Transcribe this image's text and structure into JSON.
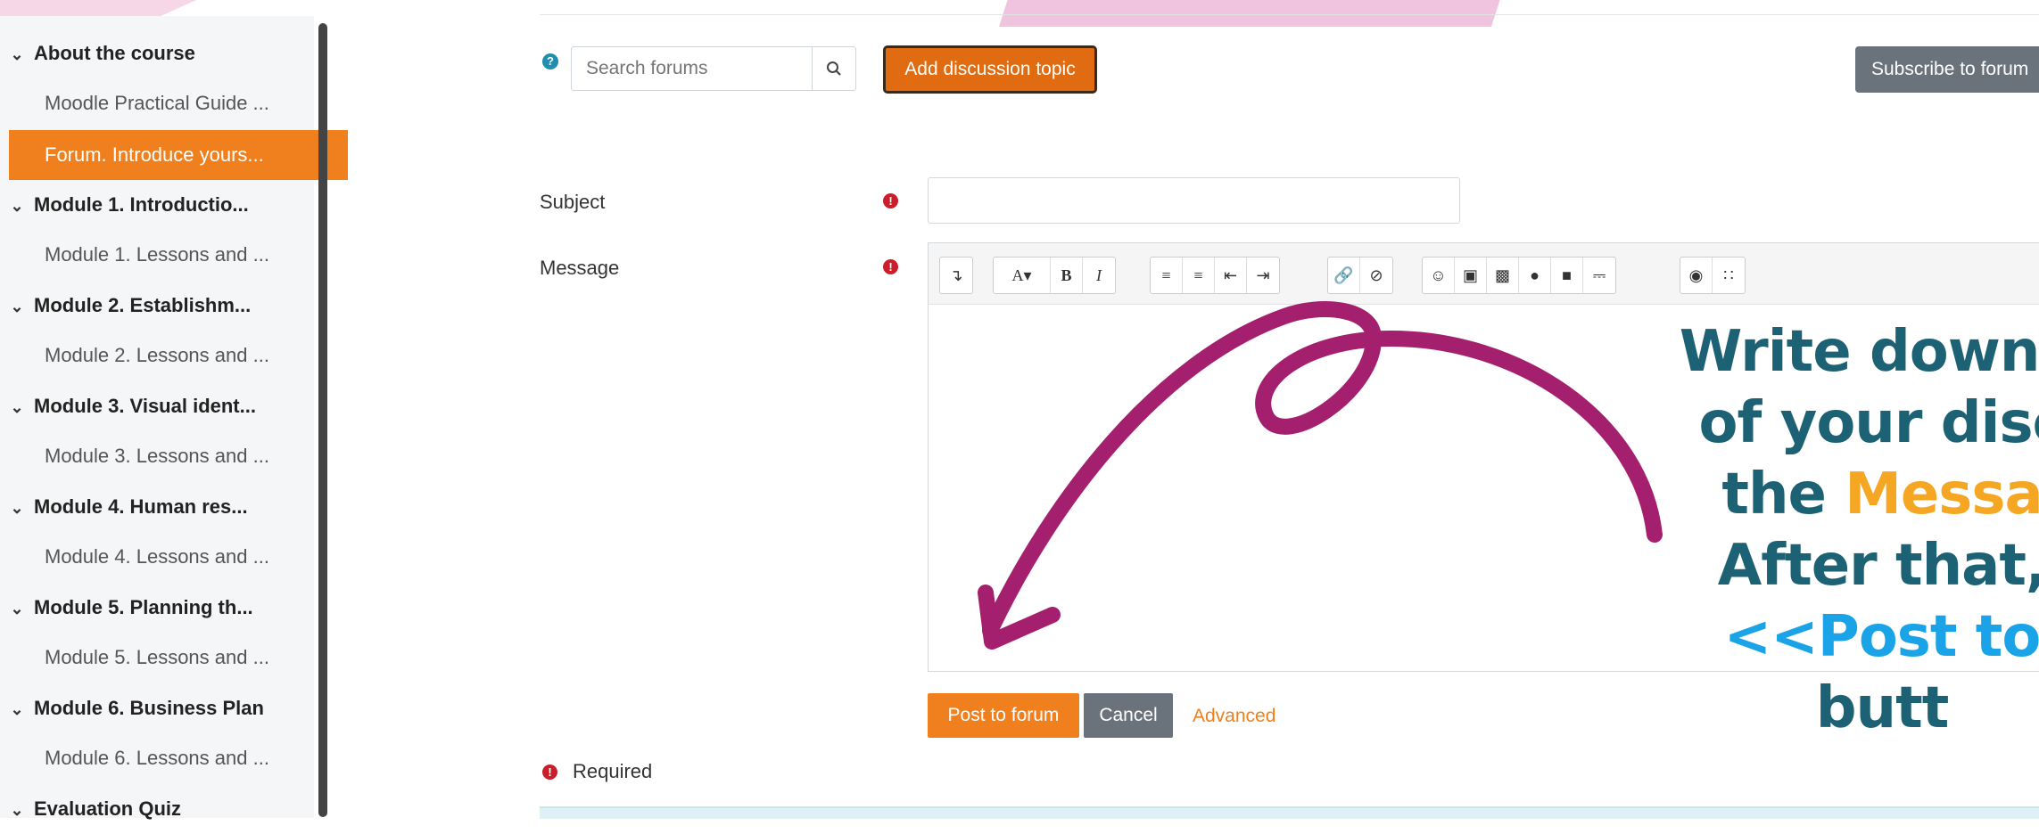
{
  "sidebar": {
    "items": [
      {
        "type": "section",
        "label": "About the course"
      },
      {
        "type": "link",
        "label": "Moodle Practical Guide ..."
      },
      {
        "type": "active",
        "label": "Forum. Introduce yours..."
      },
      {
        "type": "section",
        "label": "Module 1. Introductio..."
      },
      {
        "type": "link",
        "label": "Module 1. Lessons and ..."
      },
      {
        "type": "section",
        "label": "Module 2. Establishm..."
      },
      {
        "type": "link",
        "label": "Module 2. Lessons and ..."
      },
      {
        "type": "section",
        "label": "Module 3. Visual ident..."
      },
      {
        "type": "link",
        "label": "Module 3. Lessons and ..."
      },
      {
        "type": "section",
        "label": "Module 4. Human res..."
      },
      {
        "type": "link",
        "label": "Module 4. Lessons and ..."
      },
      {
        "type": "section",
        "label": "Module 5. Planning th..."
      },
      {
        "type": "link",
        "label": "Module 5. Lessons and ..."
      },
      {
        "type": "section",
        "label": "Module 6. Business Plan"
      },
      {
        "type": "link",
        "label": "Module 6. Lessons and ..."
      },
      {
        "type": "section",
        "label": "Evaluation Quiz"
      }
    ]
  },
  "forum": {
    "search_placeholder": "Search forums",
    "add_topic_label": "Add discussion topic",
    "subscribe_label": "Subscribe to forum"
  },
  "form": {
    "subject_label": "Subject",
    "subject_value": "",
    "message_label": "Message",
    "post_label": "Post to forum",
    "cancel_label": "Cancel",
    "advanced_label": "Advanced",
    "required_label": "Required"
  },
  "overlay": {
    "line1": "Write down t",
    "line2": "of your disc",
    "line3_a": "the ",
    "line3_b": "Messa",
    "line4": "After that,",
    "line5": "<<Post to",
    "line6": "butt"
  },
  "colors": {
    "accent_orange": "#f07f1d",
    "overlay_teal": "#1d6174",
    "arrow_magenta": "#a4206f",
    "highlight_orange": "#f5a623",
    "highlight_blue": "#1aa3e6"
  },
  "toolbar_icons": [
    "collapse-icon",
    "font-color-icon",
    "bold-icon",
    "italic-icon",
    "unordered-list-icon",
    "ordered-list-icon",
    "outdent-icon",
    "indent-icon",
    "link-icon",
    "unlink-icon",
    "emoji-icon",
    "image-icon",
    "media-icon",
    "record-audio-icon",
    "record-video-icon",
    "manage-files-icon",
    "accessibility-checker-icon",
    "screenreader-helper-icon"
  ]
}
